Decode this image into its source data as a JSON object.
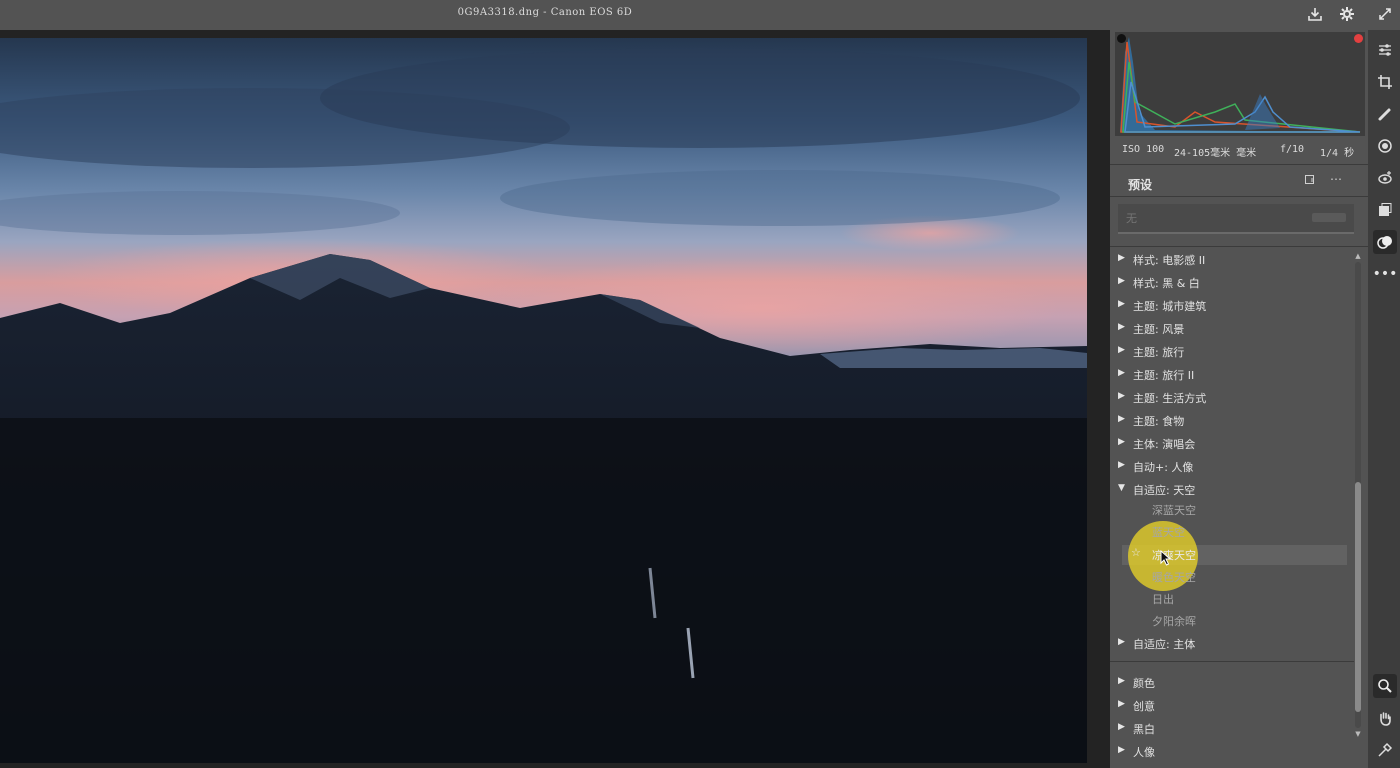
{
  "window": {
    "title": "0G9A3318.dng  -  Canon EOS 6D"
  },
  "histogram": {
    "clip_shadow_color": "#111111",
    "clip_highlight_color": "#e34040"
  },
  "exif": {
    "iso": "ISO 100",
    "lens": "24-105毫米 毫米",
    "aperture": "f/10",
    "shutter": "1/4 秒"
  },
  "presets": {
    "title": "预设",
    "search_placeholder": "无",
    "groups_top": [
      "样式: 电影感 II",
      "样式: 黑 & 白",
      "主题: 城市建筑",
      "主题: 风景",
      "主题: 旅行",
      "主题: 旅行 II",
      "主题: 生活方式",
      "主题: 食物",
      "主体: 演唱会",
      "自动+: 人像"
    ],
    "expanded_group": "自适应: 天空",
    "expanded_items": [
      "深蓝天空",
      "蓝天空",
      "凉爽天空",
      "暖色天空",
      "日出",
      "夕阳余晖"
    ],
    "group_after": "自适应: 主体",
    "groups_bottom": [
      "颜色",
      "创意",
      "黑白",
      "人像"
    ]
  },
  "tools": [
    "edit-sliders-icon",
    "crop-icon",
    "healing-brush-icon",
    "masking-icon",
    "red-eye-icon",
    "snapshots-icon",
    "presets-icon",
    "more-icon",
    "zoom-icon",
    "hand-icon",
    "sampler-icon"
  ]
}
